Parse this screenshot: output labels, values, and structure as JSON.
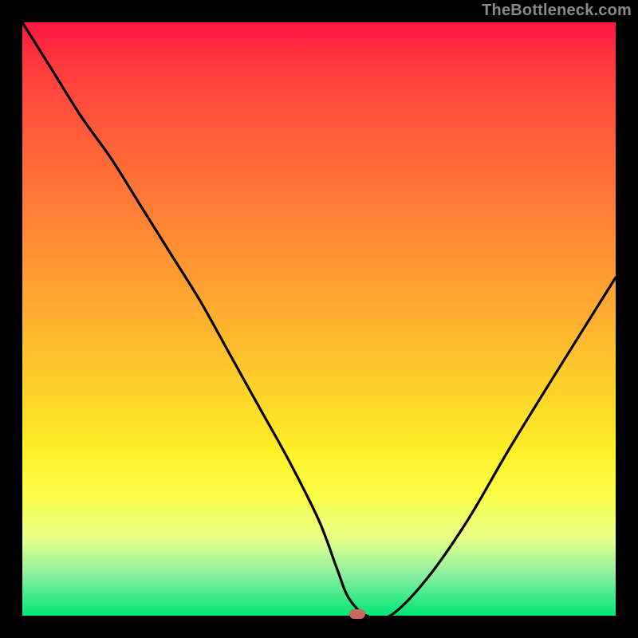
{
  "attribution": "TheBottleneck.com",
  "chart_data": {
    "type": "line",
    "title": "",
    "xlabel": "",
    "ylabel": "",
    "xlim": [
      0,
      100
    ],
    "ylim": [
      0,
      100
    ],
    "grid": false,
    "legend": false,
    "series": [
      {
        "name": "bottleneck-curve",
        "x": [
          0,
          5,
          10,
          15,
          20,
          25,
          30,
          35,
          40,
          45,
          50,
          53,
          55,
          58,
          62,
          68,
          75,
          82,
          90,
          100
        ],
        "values": [
          100,
          92,
          84,
          77,
          69,
          61,
          53,
          44,
          35,
          26,
          16,
          8,
          3,
          0,
          0,
          6,
          16,
          28,
          41,
          57
        ]
      }
    ],
    "marker": {
      "x": 56.5,
      "y": 0
    },
    "colors": {
      "curve": "#000000",
      "marker": "#c86a5a",
      "gradient_top": "#ff1744",
      "gradient_bottom": "#00e676"
    }
  }
}
